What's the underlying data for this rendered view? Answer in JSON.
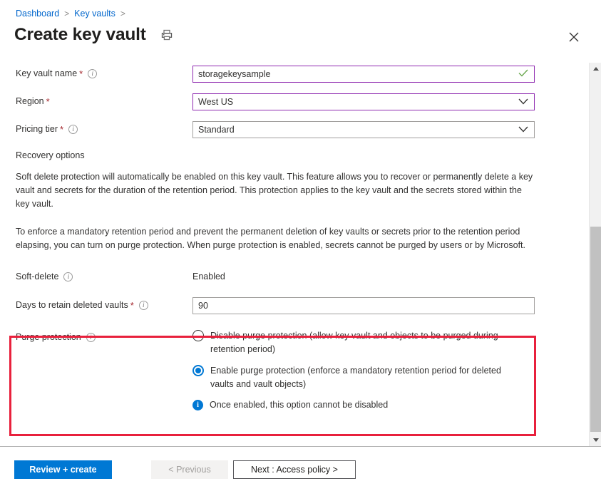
{
  "breadcrumb": {
    "items": [
      {
        "label": "Dashboard"
      },
      {
        "label": "Key vaults"
      }
    ],
    "separator": ">"
  },
  "header": {
    "title": "Create key vault",
    "print_icon": "printer-icon",
    "close_icon": "close-icon"
  },
  "form": {
    "key_vault_name": {
      "label": "Key vault name",
      "required_marker": "*",
      "info_icon": "info-icon",
      "value": "storagekeysample",
      "placeholder": "",
      "validation_icon": "checkmark-icon",
      "border_color": "#8f2ab0"
    },
    "region": {
      "label": "Region",
      "required_marker": "*",
      "value": "West US",
      "dropdown_icon": "chevron-down-icon",
      "border_color": "#8f2ab0"
    },
    "pricing_tier": {
      "label": "Pricing tier",
      "required_marker": "*",
      "info_icon": "info-icon",
      "value": "Standard",
      "dropdown_icon": "chevron-down-icon",
      "border_color": "#a19f9d"
    },
    "recovery_options": {
      "heading": "Recovery options",
      "paragraph_1": "Soft delete protection will automatically be enabled on this key vault. This feature allows you to recover or permanently delete a key vault and secrets for the duration of the retention period. This protection applies to the key vault and the secrets stored within the key vault.",
      "paragraph_2": "To enforce a mandatory retention period and prevent the permanent deletion of key vaults or secrets prior to the retention period elapsing, you can turn on purge protection. When purge protection is enabled, secrets cannot be purged by users or by Microsoft."
    },
    "soft_delete": {
      "label": "Soft-delete",
      "info_icon": "info-icon",
      "value": "Enabled"
    },
    "days_to_retain": {
      "label": "Days to retain deleted vaults",
      "required_marker": "*",
      "info_icon": "info-icon",
      "value": "90",
      "placeholder": "",
      "border_color": "#a19f9d"
    },
    "purge_protection": {
      "label": "Purge protection",
      "info_icon": "info-icon",
      "highlight_color": "#e8203c",
      "options": [
        {
          "label": "Disable purge protection (allow key vault and objects to be purged during retention period)",
          "selected": false
        },
        {
          "label": "Enable purge protection (enforce a mandatory retention period for deleted vaults and vault objects)",
          "selected": true
        }
      ],
      "note": {
        "icon": "info-filled-icon",
        "text": "Once enabled, this option cannot be disabled",
        "color": "#0078d4"
      }
    }
  },
  "scrollbar": {
    "up_arrow_icon": "caret-up-icon",
    "down_arrow_icon": "caret-down-icon",
    "thumb_label": "vertical-scroll-thumb"
  },
  "footer": {
    "review_create_label": "Review + create",
    "previous_label": "< Previous",
    "next_label": "Next : Access policy >",
    "primary_color": "#0078d4"
  }
}
